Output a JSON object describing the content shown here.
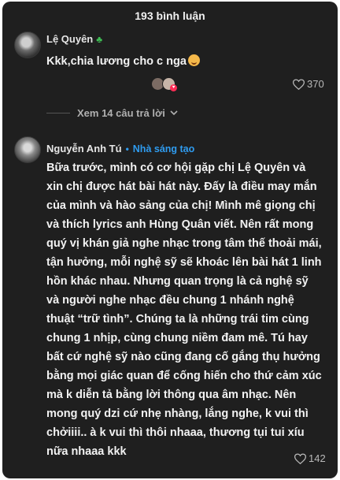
{
  "header": {
    "title": "193 bình luận"
  },
  "comments": [
    {
      "author": "Lệ Quyên",
      "badge_icon": "four-leaf-clover-icon",
      "text": "Kkk,chia lương cho c nga",
      "emoji": "smiling-face-with-hearts-emoji",
      "likes": "370",
      "replies_label": "Xem 14 câu trả lời"
    },
    {
      "author": "Nguyễn Anh Tú",
      "author_tag": "Nhà sáng tạo",
      "text": "Bữa trước, mình có cơ hội gặp chị Lệ Quyên và xin chị được hát bài hát này. Đấy là điều may mắn của mình và hào sảng của chị! Mình mê giọng chị và thích lyrics anh Hùng Quân viết. Nên rất mong quý vị khán giả nghe nhạc trong tâm thế thoải mái, tận hưởng, mỗi nghệ sỹ sẽ khoác lên bài hát 1 linh hồn khác nhau. Nhưng quan trọng là cả nghệ sỹ và người nghe nhạc đều chung 1 nhánh nghệ thuật “trữ tình”. Chúng ta là những trái tim cùng chung 1 nhịp, cùng chung niềm đam mê. Tú hay bất cứ nghệ sỹ nào cũng đang cố gắng thụ hưởng bằng mọi giác quan để cống hiến cho thứ cảm xúc mà k diễn tả bằng lời thông qua âm nhạc. Nên mong quý dzi cứ nhẹ nhàng, lắng nghe, k vui thì chởiiii.. à k vui thì thôi nhaaa, thương tụi tui xíu nữa nhaaa kkk",
      "likes": "142"
    }
  ],
  "colors": {
    "background": "#1f1f1f",
    "creator_tag": "#2f9cf0",
    "clover": "#3fbf55",
    "like_badge": "#fe2c55"
  }
}
